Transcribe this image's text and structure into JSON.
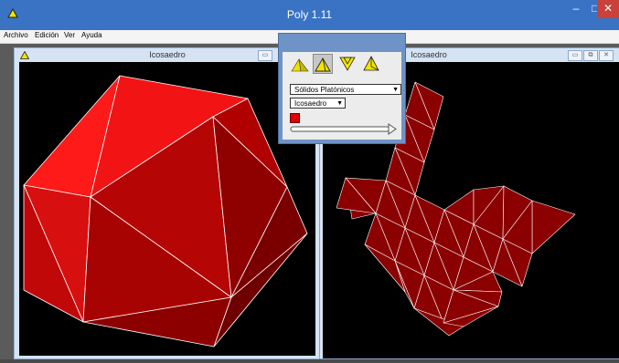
{
  "window": {
    "title": "Poly 1.11",
    "min": "–",
    "max": "□",
    "close": "✕"
  },
  "menu": [
    "Archivo",
    "Edición",
    "Ver",
    "Ayuda"
  ],
  "left_window": {
    "title": "Icosaedro",
    "min": "▭"
  },
  "right_window": {
    "title": "Icosaedro",
    "min": "▭",
    "restore": "⧉",
    "close": "✕"
  },
  "panel": {
    "family_select": "Sólidos Platónicos",
    "solid_select": "Icosaedro",
    "arrow": "▼",
    "color": "#e00000"
  },
  "icons": [
    "app-triangle-icon",
    "solid-view-icon",
    "solid-outline-icon",
    "unfold-icon",
    "vertex-icon"
  ]
}
